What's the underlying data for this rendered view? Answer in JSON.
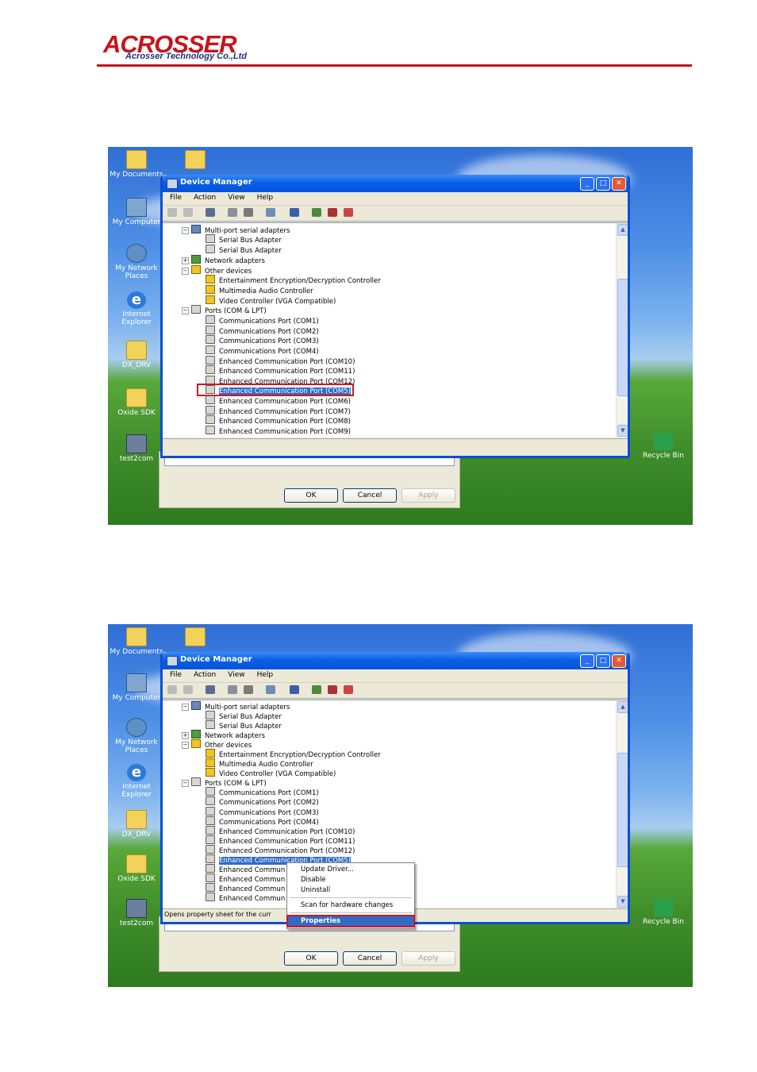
{
  "header": {
    "brand": "ACROSSER",
    "company": "Acrosser Technology Co.,Ltd",
    "accent_color": "#c8141a"
  },
  "desktop": {
    "icons": [
      "My Documents",
      "My Computer",
      "My Network Places",
      "Internet Explorer",
      "DX_DRV",
      "Oxide SDK",
      "test2com"
    ],
    "recycle_bin": "Recycle Bin"
  },
  "window": {
    "title": "Device Manager",
    "menu": [
      "File",
      "Action",
      "View",
      "Help"
    ],
    "buttons": {
      "ok": "OK",
      "cancel": "Cancel",
      "apply": "Apply"
    }
  },
  "tree": [
    "Multi-port serial adapters",
    "Serial Bus Adapter",
    "Serial Bus Adapter",
    "Network adapters",
    "Other devices",
    "Entertainment Encryption/Decryption Controller",
    "Multimedia Audio Controller",
    "Video Controller (VGA Compatible)",
    "Ports (COM & LPT)",
    "Communications Port (COM1)",
    "Communications Port (COM2)",
    "Communications Port (COM3)",
    "Communications Port (COM4)",
    "Enhanced Communication Port (COM10)",
    "Enhanced Communication Port (COM11)",
    "Enhanced Communication Port (COM12)",
    "Enhanced Communication Port (COM5)",
    "Enhanced Communication Port (COM6)",
    "Enhanced Communication Port (COM7)",
    "Enhanced Communication Port (COM8)",
    "Enhanced Communication Port (COM9)"
  ],
  "tree_short": [
    "Enhanced Commun",
    "Enhanced Commun",
    "Enhanced Commun",
    "Enhanced Commun"
  ],
  "context_menu": {
    "update_driver": "Update Driver...",
    "disable": "Disable",
    "uninstall": "Uninstall",
    "scan": "Scan for hardware changes",
    "properties": "Properties"
  },
  "status_text": "Opens property sheet for the curr"
}
